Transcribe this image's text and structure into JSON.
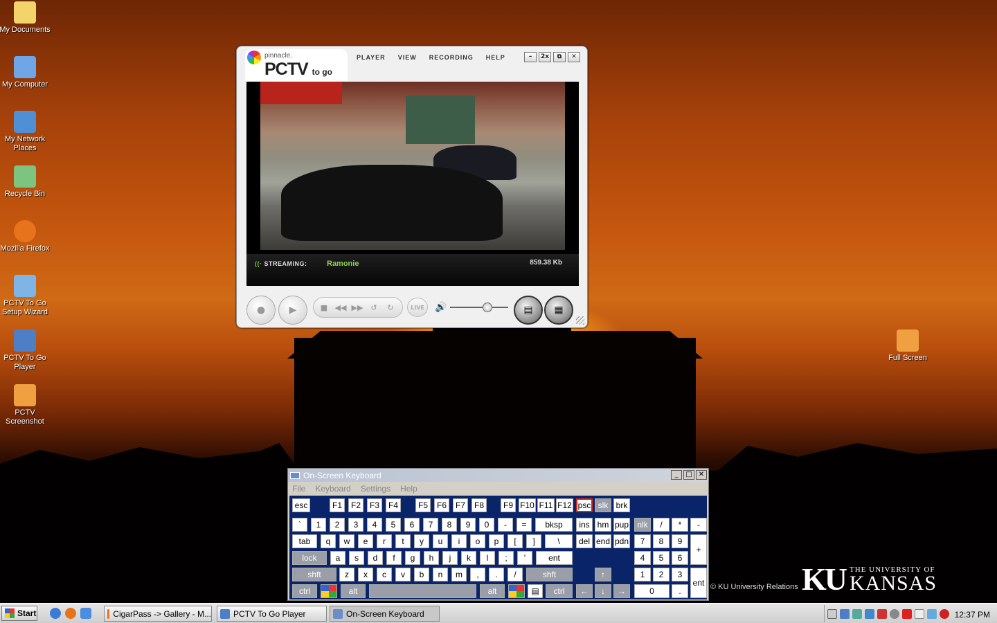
{
  "desktop": {
    "icons": [
      {
        "label": "My Documents",
        "color": "#f3d46a"
      },
      {
        "label": "My Computer",
        "color": "#6fa6e8"
      },
      {
        "label": "My Network Places",
        "color": "#4e8fd6"
      },
      {
        "label": "Recycle Bin",
        "color": "#7cc47f"
      },
      {
        "label": "Mozilla Firefox",
        "color": "#e8731d"
      },
      {
        "label": "PCTV To Go Setup Wizard",
        "color": "#7fb4e6"
      },
      {
        "label": "PCTV To Go Player",
        "color": "#4e7fc6"
      },
      {
        "label": "PCTV Screenshot",
        "color": "#f0a040"
      },
      {
        "label": "Full Screen",
        "color": "#f0a040"
      }
    ],
    "ku_copyright": "© KU University Relations",
    "ku_logo": {
      "mark": "KU",
      "line1": "THE UNIVERSITY OF",
      "line2": "KANSAS"
    }
  },
  "player": {
    "brand_small": "pinnacle.",
    "brand_big": "PCTV",
    "brand_sub": "to go",
    "menu": [
      "PLAYER",
      "VIEW",
      "RECORDING",
      "HELP"
    ],
    "window_controls": [
      "–",
      "2x",
      "⧉",
      "✕"
    ],
    "status_label": "STREAMING:",
    "channel": "Ramonie",
    "bitrate": "859.38 Kb",
    "live_label": "LIVE",
    "volume_level": 0.64
  },
  "osk": {
    "title": "On-Screen Keyboard",
    "menu": [
      "File",
      "Keyboard",
      "Settings",
      "Help"
    ],
    "window_controls": [
      "_",
      "□",
      "✕"
    ]
  },
  "taskbar": {
    "start_label": "Start",
    "tasks": [
      "CigarPass -> Gallery - M...",
      "PCTV To Go Player",
      "On-Screen Keyboard"
    ],
    "clock": "12:37 PM"
  }
}
